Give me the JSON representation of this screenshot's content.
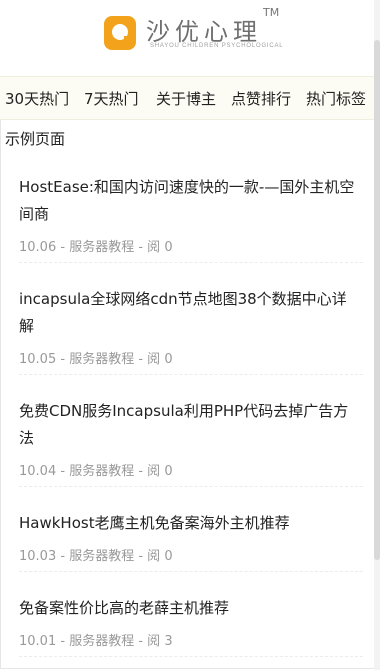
{
  "brand": {
    "name_cn": "沙优心理",
    "trademark": "TM",
    "name_en": "SHAYOU CHILDREN PSYCHOLOGICAL",
    "accent_color": "#f2a21b",
    "logo_icon": "q-logo-icon"
  },
  "nav": {
    "items": [
      {
        "label": "30天热门"
      },
      {
        "label": "7天热门"
      },
      {
        "label": "关于博主"
      },
      {
        "label": "点赞排行"
      },
      {
        "label": "热门标签"
      }
    ]
  },
  "page": {
    "label": "示例页面"
  },
  "posts": [
    {
      "title": "HostEase:和国内访问速度快的一款-—国外主机空间商",
      "date": "10.06",
      "category": "服务器教程",
      "reads_label": "阅",
      "reads": "0"
    },
    {
      "title": "incapsula全球网络cdn节点地图38个数据中心详解",
      "date": "10.05",
      "category": "服务器教程",
      "reads_label": "阅",
      "reads": "0"
    },
    {
      "title": "免费CDN服务Incapsula利用PHP代码去掉广告方法",
      "date": "10.04",
      "category": "服务器教程",
      "reads_label": "阅",
      "reads": "0"
    },
    {
      "title": "HawkHost老鹰主机免备案海外主机推荐",
      "date": "10.03",
      "category": "服务器教程",
      "reads_label": "阅",
      "reads": "0"
    },
    {
      "title": "免备案性价比高的老薛主机推荐",
      "date": "10.01",
      "category": "服务器教程",
      "reads_label": "阅",
      "reads": "3"
    }
  ],
  "separator": " - "
}
